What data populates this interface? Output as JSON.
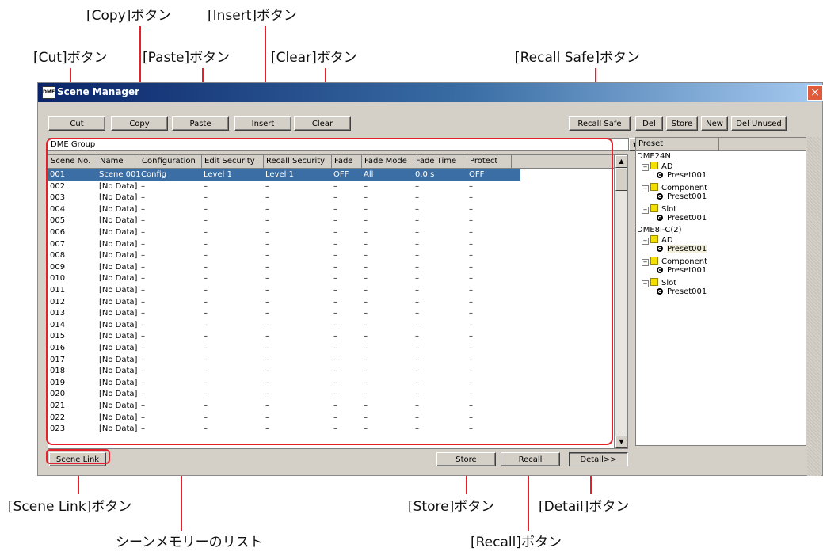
{
  "callouts": {
    "copy": "[Copy]ボタン",
    "insert": "[Insert]ボタン",
    "cut": "[Cut]ボタン",
    "paste": "[Paste]ボタン",
    "clear": "[Clear]ボタン",
    "recall_safe": "[Recall Safe]ボタン",
    "scene_link": "[Scene Link]ボタン",
    "store": "[Store]ボタン",
    "detail": "[Detail]ボタン",
    "scene_list": "シーンメモリーのリスト",
    "recall": "[Recall]ボタン"
  },
  "window": {
    "title": "Scene Manager",
    "icon_text": "DME",
    "close": "×"
  },
  "toolbar": {
    "cut": "Cut",
    "copy": "Copy",
    "paste": "Paste",
    "insert": "Insert",
    "clear": "Clear",
    "recall_safe": "Recall Safe",
    "del": "Del",
    "store": "Store",
    "new": "New",
    "del_unused": "Del Unused"
  },
  "group_select": {
    "value": "DME Group",
    "arrow": "▼"
  },
  "table": {
    "columns": [
      "Scene No.",
      "Name",
      "Configuration",
      "Edit Security",
      "Recall Security",
      "Fade",
      "Fade Mode",
      "Fade Time",
      "Protect"
    ],
    "rows": [
      [
        "001",
        "Scene 001",
        "Config",
        "Level 1",
        "Level 1",
        "OFF",
        "All",
        "0.0 s",
        "OFF"
      ],
      [
        "002",
        "[No Data]",
        "–",
        "–",
        "–",
        "–",
        "–",
        "–",
        "–"
      ],
      [
        "003",
        "[No Data]",
        "–",
        "–",
        "–",
        "–",
        "–",
        "–",
        "–"
      ],
      [
        "004",
        "[No Data]",
        "–",
        "–",
        "–",
        "–",
        "–",
        "–",
        "–"
      ],
      [
        "005",
        "[No Data]",
        "–",
        "–",
        "–",
        "–",
        "–",
        "–",
        "–"
      ],
      [
        "006",
        "[No Data]",
        "–",
        "–",
        "–",
        "–",
        "–",
        "–",
        "–"
      ],
      [
        "007",
        "[No Data]",
        "–",
        "–",
        "–",
        "–",
        "–",
        "–",
        "–"
      ],
      [
        "008",
        "[No Data]",
        "–",
        "–",
        "–",
        "–",
        "–",
        "–",
        "–"
      ],
      [
        "009",
        "[No Data]",
        "–",
        "–",
        "–",
        "–",
        "–",
        "–",
        "–"
      ],
      [
        "010",
        "[No Data]",
        "–",
        "–",
        "–",
        "–",
        "–",
        "–",
        "–"
      ],
      [
        "011",
        "[No Data]",
        "–",
        "–",
        "–",
        "–",
        "–",
        "–",
        "–"
      ],
      [
        "012",
        "[No Data]",
        "–",
        "–",
        "–",
        "–",
        "–",
        "–",
        "–"
      ],
      [
        "013",
        "[No Data]",
        "–",
        "–",
        "–",
        "–",
        "–",
        "–",
        "–"
      ],
      [
        "014",
        "[No Data]",
        "–",
        "–",
        "–",
        "–",
        "–",
        "–",
        "–"
      ],
      [
        "015",
        "[No Data]",
        "–",
        "–",
        "–",
        "–",
        "–",
        "–",
        "–"
      ],
      [
        "016",
        "[No Data]",
        "–",
        "–",
        "–",
        "–",
        "–",
        "–",
        "–"
      ],
      [
        "017",
        "[No Data]",
        "–",
        "–",
        "–",
        "–",
        "–",
        "–",
        "–"
      ],
      [
        "018",
        "[No Data]",
        "–",
        "–",
        "–",
        "–",
        "–",
        "–",
        "–"
      ],
      [
        "019",
        "[No Data]",
        "–",
        "–",
        "–",
        "–",
        "–",
        "–",
        "–"
      ],
      [
        "020",
        "[No Data]",
        "–",
        "–",
        "–",
        "–",
        "–",
        "–",
        "–"
      ],
      [
        "021",
        "[No Data]",
        "–",
        "–",
        "–",
        "–",
        "–",
        "–",
        "–"
      ],
      [
        "022",
        "[No Data]",
        "–",
        "–",
        "–",
        "–",
        "–",
        "–",
        "–"
      ],
      [
        "023",
        "[No Data]",
        "–",
        "–",
        "–",
        "–",
        "–",
        "–",
        "–"
      ]
    ],
    "selected_row": 0
  },
  "preset_panel": {
    "header": "Preset",
    "tree": [
      {
        "label": "DME24N",
        "kind": "device"
      },
      {
        "label": "AD",
        "kind": "folder"
      },
      {
        "label": "Preset001",
        "kind": "preset"
      },
      {
        "label": "Component",
        "kind": "folder"
      },
      {
        "label": "Preset001",
        "kind": "preset"
      },
      {
        "label": "Slot",
        "kind": "folder"
      },
      {
        "label": "Preset001",
        "kind": "preset"
      },
      {
        "label": "DME8i-C(2)",
        "kind": "device"
      },
      {
        "label": "AD",
        "kind": "folder"
      },
      {
        "label": "Preset001",
        "kind": "preset",
        "highlighted": true
      },
      {
        "label": "Component",
        "kind": "folder"
      },
      {
        "label": "Preset001",
        "kind": "preset"
      },
      {
        "label": "Slot",
        "kind": "folder"
      },
      {
        "label": "Preset001",
        "kind": "preset"
      }
    ]
  },
  "bottom": {
    "scene_link": "Scene Link",
    "store": "Store",
    "recall": "Recall",
    "detail": "Detail>>"
  },
  "colors": {
    "accent_red": "#e4202a",
    "selection": "#3a6ea5",
    "title_blue": "#0a246a"
  }
}
